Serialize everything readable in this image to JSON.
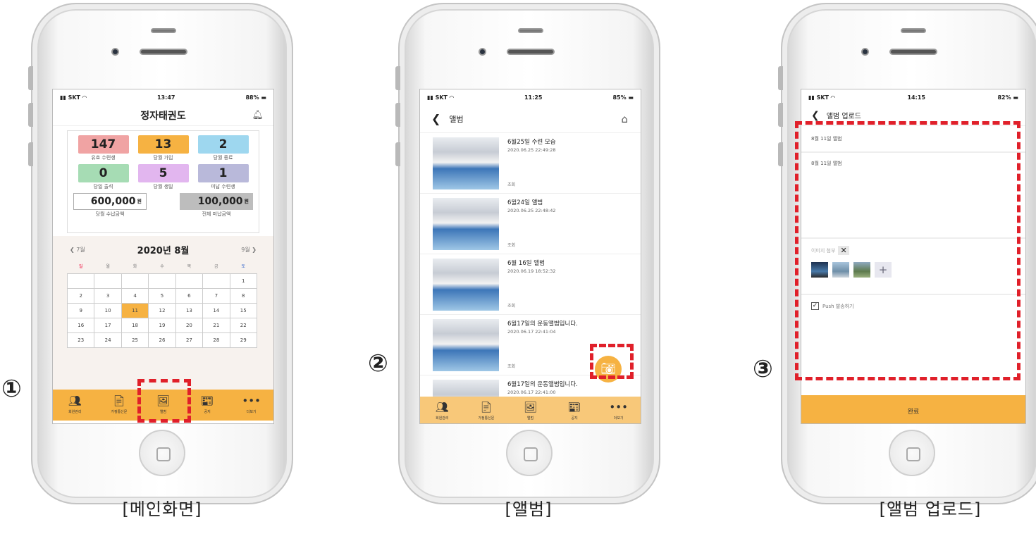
{
  "captions": [
    "[메인화면]",
    "[앨범]",
    "[앨범 업로드]"
  ],
  "markers": [
    "①",
    "②",
    "③"
  ],
  "main": {
    "status": {
      "carrier": "SKT",
      "time": "13:47",
      "battery": "88%"
    },
    "title": "정자태권도",
    "stats": [
      {
        "value": "147",
        "label": "유효 수련생",
        "color": "#f0a3a3"
      },
      {
        "value": "13",
        "label": "당월 가입",
        "color": "#f6b242"
      },
      {
        "value": "2",
        "label": "당월 종료",
        "color": "#9ed7ef"
      },
      {
        "value": "0",
        "label": "당일 출석",
        "color": "#a6dcb4"
      },
      {
        "value": "5",
        "label": "당월 생일",
        "color": "#e2b6ef"
      },
      {
        "value": "1",
        "label": "미납 수련생",
        "color": "#b9b9da"
      }
    ],
    "amount_paid": {
      "value": "600,000",
      "unit": "원",
      "label": "당월 수납금액"
    },
    "amount_unpaid": {
      "value": "100,000",
      "unit": "원",
      "label": "전체 미납금액"
    },
    "calendar": {
      "prev": "7월",
      "title": "2020년 8월",
      "next": "9월",
      "weekdays": [
        "일",
        "월",
        "화",
        "수",
        "목",
        "금",
        "토"
      ],
      "rows": [
        [
          "",
          "",
          "",
          "",
          "",
          "",
          "1"
        ],
        [
          "2",
          "3",
          "4",
          "5",
          "6",
          "7",
          "8"
        ],
        [
          "9",
          "10",
          "11",
          "12",
          "13",
          "14",
          "15"
        ],
        [
          "16",
          "17",
          "18",
          "19",
          "20",
          "21",
          "22"
        ],
        [
          "23",
          "24",
          "25",
          "26",
          "27",
          "28",
          "29"
        ]
      ],
      "today": "11"
    },
    "tabs": [
      "회원관리",
      "가정통신문",
      "앨범",
      "공지",
      "더보기"
    ]
  },
  "album": {
    "status": {
      "carrier": "SKT",
      "time": "11:25",
      "battery": "85%"
    },
    "title": "앨범",
    "items": [
      {
        "title": "6월25일 수련 모습",
        "date": "2020.06.25 22:49:28",
        "views": "조회"
      },
      {
        "title": "6월24일 앨범",
        "date": "2020.06.25 22:48:42",
        "views": "조회"
      },
      {
        "title": "6월 16일 앨범",
        "date": "2020.06.19 18:52:32",
        "views": "조회"
      },
      {
        "title": "6월17일의 운동앨범입니다.",
        "date": "2020.06.17 22:41:04",
        "views": "조회"
      },
      {
        "title": "6월17일의 운동앨범입니다.",
        "date": "2020.06.17 22:41:00",
        "views": ""
      }
    ],
    "tabs": [
      "회원관리",
      "가정통신문",
      "앨범",
      "공지",
      "더보기"
    ]
  },
  "upload": {
    "status": {
      "carrier": "SKT",
      "time": "14:15",
      "battery": "82%"
    },
    "title": "앨범 업로드",
    "subject": "8월 11일 앨범",
    "body": "8월 11일 앨범",
    "attach_label": "이미지 첨부",
    "push_label": "Push 발송하기",
    "submit": "완료"
  }
}
